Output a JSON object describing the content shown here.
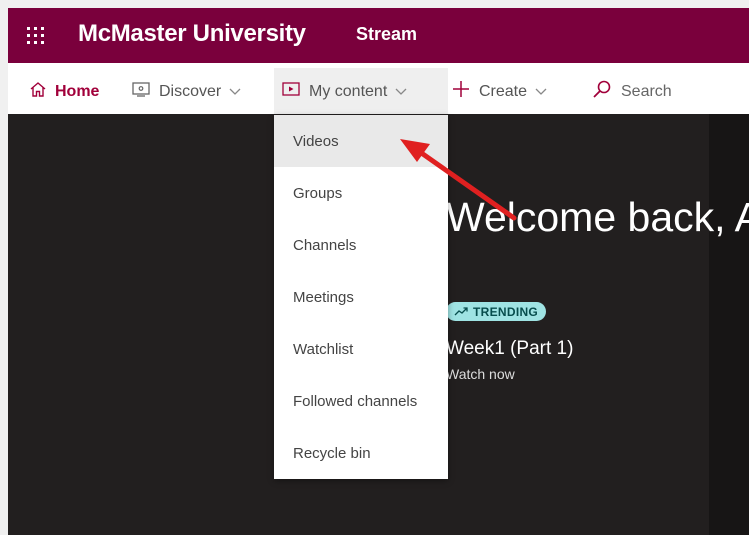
{
  "header": {
    "brand": "McMaster University",
    "app_name": "Stream",
    "brand_color": "#7a003c"
  },
  "nav": {
    "home": "Home",
    "discover": "Discover",
    "my_content": "My content",
    "create": "Create",
    "search": "Search",
    "icons": [
      "home-icon",
      "discover-icon",
      "video-icon",
      "plus-icon",
      "search-icon",
      "chevron-down-icon"
    ]
  },
  "menu": {
    "items": [
      "Videos",
      "Groups",
      "Channels",
      "Meetings",
      "Watchlist",
      "Followed channels",
      "Recycle bin"
    ]
  },
  "main": {
    "welcome": "Welcome back, A",
    "badge": "TRENDING",
    "video_title": "Week1 (Part 1)",
    "watch_now": "Watch now",
    "badge_color": "#9fe3e3"
  },
  "annotation": {
    "arrow_color": "#e02020"
  }
}
